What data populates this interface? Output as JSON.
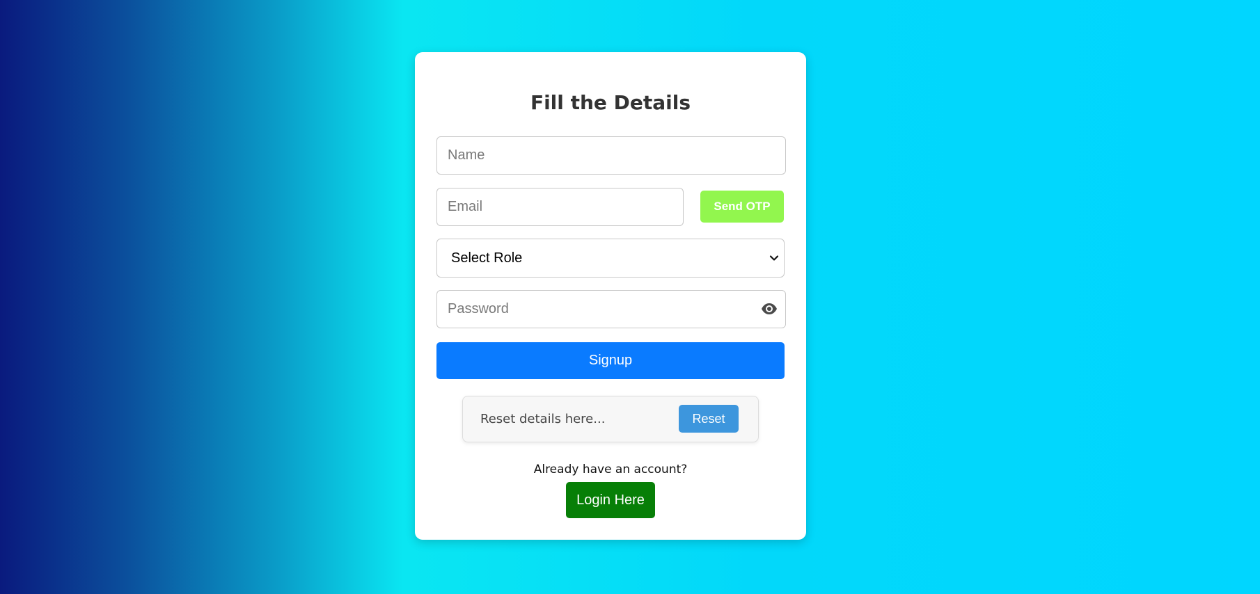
{
  "form": {
    "title": "Fill the Details",
    "name_placeholder": "Name",
    "email_placeholder": "Email",
    "send_otp_label": "Send OTP",
    "role_selected": "Select Role",
    "password_placeholder": "Password",
    "signup_label": "Signup",
    "reset_text": "Reset details here...",
    "reset_label": "Reset",
    "already_text": "Already have an account?",
    "login_label": "Login Here"
  },
  "colors": {
    "send_otp": "#92f64e",
    "signup": "#0a7bff",
    "reset": "#3d96dd",
    "login": "#077f07"
  },
  "icons": {
    "password_toggle": "eye-icon",
    "select_arrow": "chevron-down-icon"
  }
}
